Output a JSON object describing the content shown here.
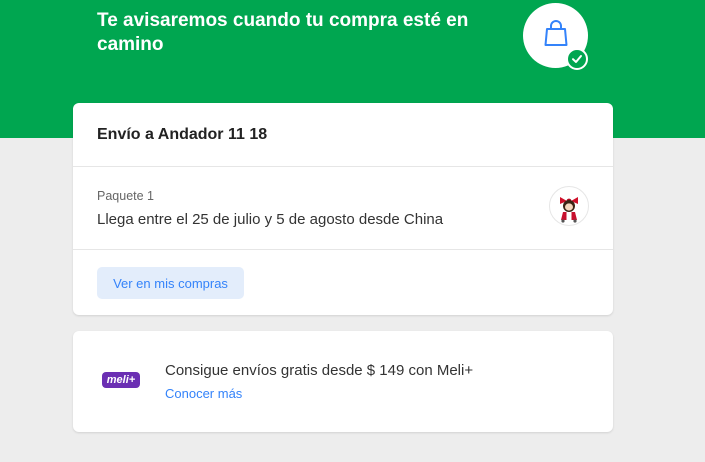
{
  "hero": {
    "title": "Te avisaremos cuando tu compra esté en camino",
    "icon": "shopping-bag-icon",
    "status_icon": "check-icon",
    "background_color": "#00a650"
  },
  "shipment": {
    "title": "Envío a Andador 11 18",
    "package_label": "Paquete 1",
    "eta": "Llega entre el 25 de julio y 5 de agosto desde China",
    "product_thumbnail": "product-figurine-thumbnail",
    "view_button_label": "Ver en mis compras"
  },
  "meli_plus": {
    "logo_text": "meli+",
    "message": "Consigue envíos gratis desde $ 149 con Meli+",
    "link_label": "Conocer más",
    "brand_color": "#6b2fb3"
  },
  "colors": {
    "link": "#3483fa",
    "button_bg": "#e3edfb",
    "page_bg": "#ededed"
  }
}
